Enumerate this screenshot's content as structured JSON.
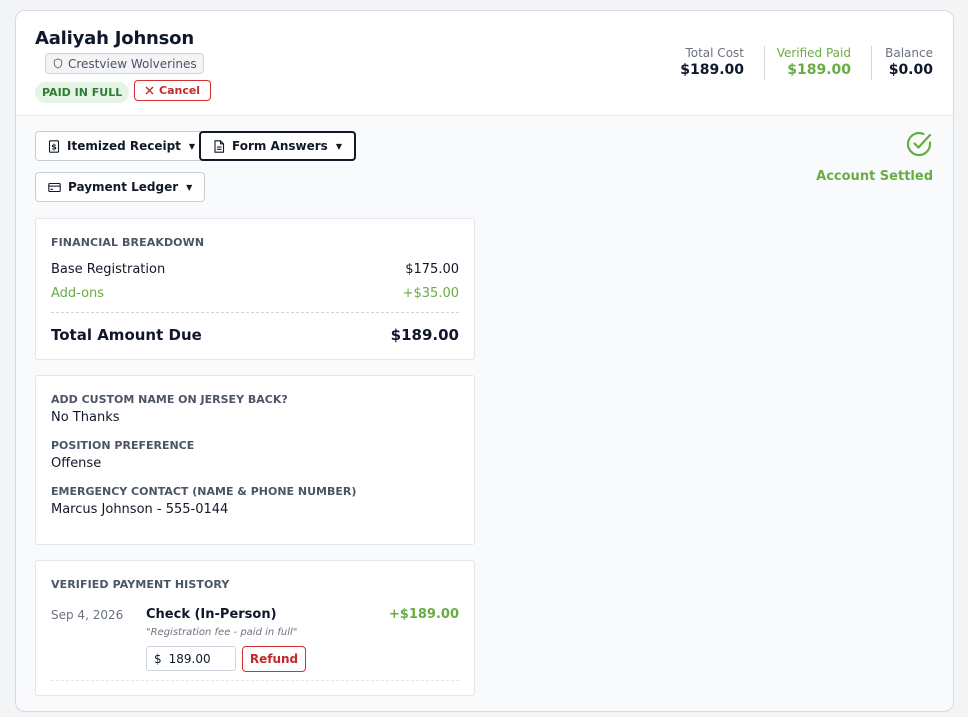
{
  "header": {
    "name": "Aaliyah Johnson",
    "team": "Crestview Wolverines",
    "status_badge": "PAID IN FULL",
    "cancel_label": "Cancel"
  },
  "summary": {
    "total_cost_label": "Total Cost",
    "total_cost": "$189.00",
    "verified_paid_label": "Verified Paid",
    "verified_paid": "$189.00",
    "balance_label": "Balance",
    "balance": "$0.00"
  },
  "toolbar": {
    "itemized_receipt": "Itemized Receipt",
    "form_answers": "Form Answers",
    "payment_ledger": "Payment Ledger"
  },
  "settled": {
    "label": "Account Settled"
  },
  "breakdown": {
    "title": "FINANCIAL BREAKDOWN",
    "base_label": "Base Registration",
    "base_value": "$175.00",
    "addons_label": "Add-ons",
    "addons_value": "+$35.00",
    "total_label": "Total Amount Due",
    "total_value": "$189.00"
  },
  "form_answers": [
    {
      "question": "ADD CUSTOM NAME ON JERSEY BACK?",
      "answer": "No Thanks"
    },
    {
      "question": "POSITION PREFERENCE",
      "answer": "Offense"
    },
    {
      "question": "EMERGENCY CONTACT (NAME & PHONE NUMBER)",
      "answer": "Marcus Johnson - 555-0144"
    }
  ],
  "payment_history": {
    "title": "VERIFIED PAYMENT HISTORY",
    "date": "Sep 4, 2026",
    "method": "Check (In-Person)",
    "note": "\"Registration fee - paid in full\"",
    "amount": "+$189.00",
    "currency_symbol": "$",
    "refund_amount": "189.00",
    "refund_label": "Refund"
  },
  "colors": {
    "accent_green": "#6aac44",
    "danger_red": "#c62828",
    "badge_green_bg": "#e6f4e6"
  },
  "icons": {
    "team": "shield-icon",
    "cancel": "close-icon",
    "receipt": "receipt-icon",
    "form": "document-icon",
    "ledger": "credit-card-icon",
    "settled": "check-circle-icon"
  }
}
